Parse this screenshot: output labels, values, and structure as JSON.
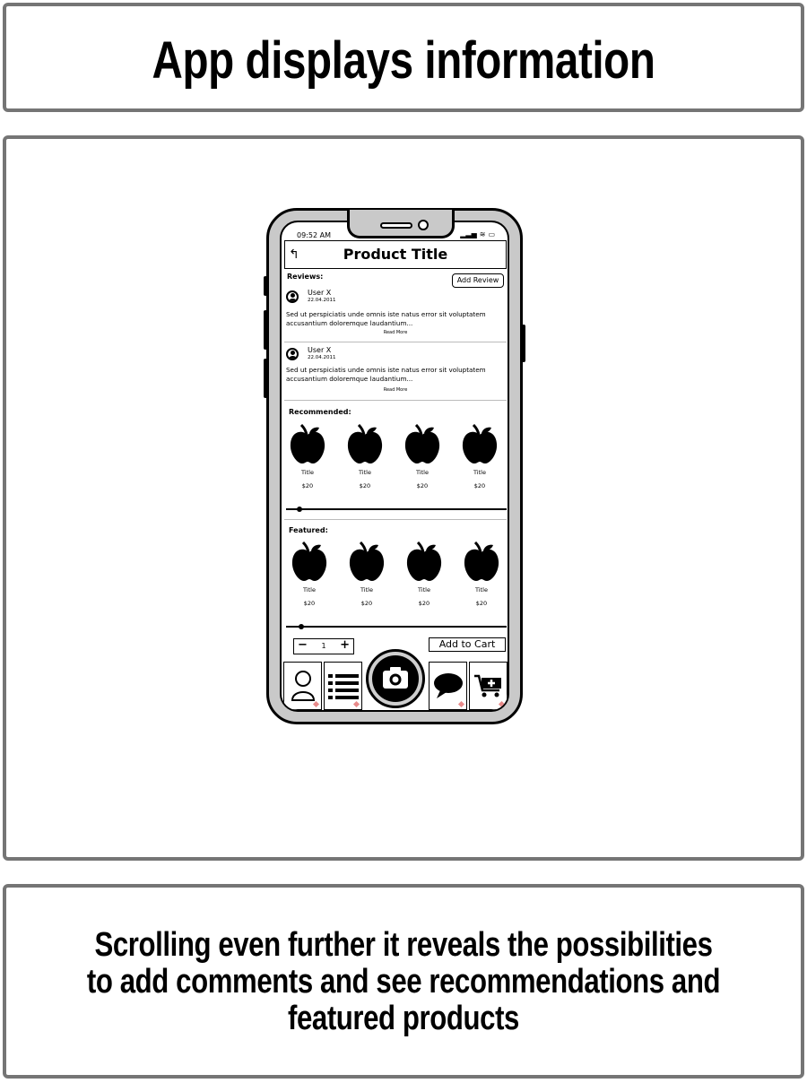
{
  "header": {
    "title": "App displays information"
  },
  "caption": {
    "text": "Scrolling even further it reveals the possibilities to add comments and see recommendations and featured products"
  },
  "phone": {
    "status_bar": {
      "time": "09:52 AM"
    },
    "title": "Product Title",
    "reviews": {
      "label": "Reviews:",
      "add_button": "Add Review",
      "items": [
        {
          "user": "User X",
          "date": "22.04.2011",
          "text": "Sed ut perspiciatis unde omnis iste natus error sit voluptatem accusantium doloremque laudantium...",
          "more": "Read More"
        },
        {
          "user": "User X",
          "date": "22.04.2011",
          "text": "Sed ut perspiciatis unde omnis iste natus error sit voluptatem accusantium doloremque laudantium...",
          "more": "Read More"
        }
      ]
    },
    "recommended": {
      "label": "Recommended:",
      "items": [
        {
          "title": "Title",
          "price": "$20"
        },
        {
          "title": "Title",
          "price": "$20"
        },
        {
          "title": "Title",
          "price": "$20"
        },
        {
          "title": "Title",
          "price": "$20"
        }
      ]
    },
    "featured": {
      "label": "Featured:",
      "items": [
        {
          "title": "Title",
          "price": "$20"
        },
        {
          "title": "Title",
          "price": "$20"
        },
        {
          "title": "Title",
          "price": "$20"
        },
        {
          "title": "Title",
          "price": "$20"
        }
      ]
    },
    "quantity": {
      "minus": "−",
      "value": "1",
      "plus": "+"
    },
    "add_to_cart": "Add to Cart",
    "tabs": [
      {
        "icon": "user-icon"
      },
      {
        "icon": "list-icon"
      },
      {
        "icon": "camera-icon"
      },
      {
        "icon": "chat-icon"
      },
      {
        "icon": "cart-add-icon"
      }
    ],
    "accent_color": "#e88a8a"
  }
}
